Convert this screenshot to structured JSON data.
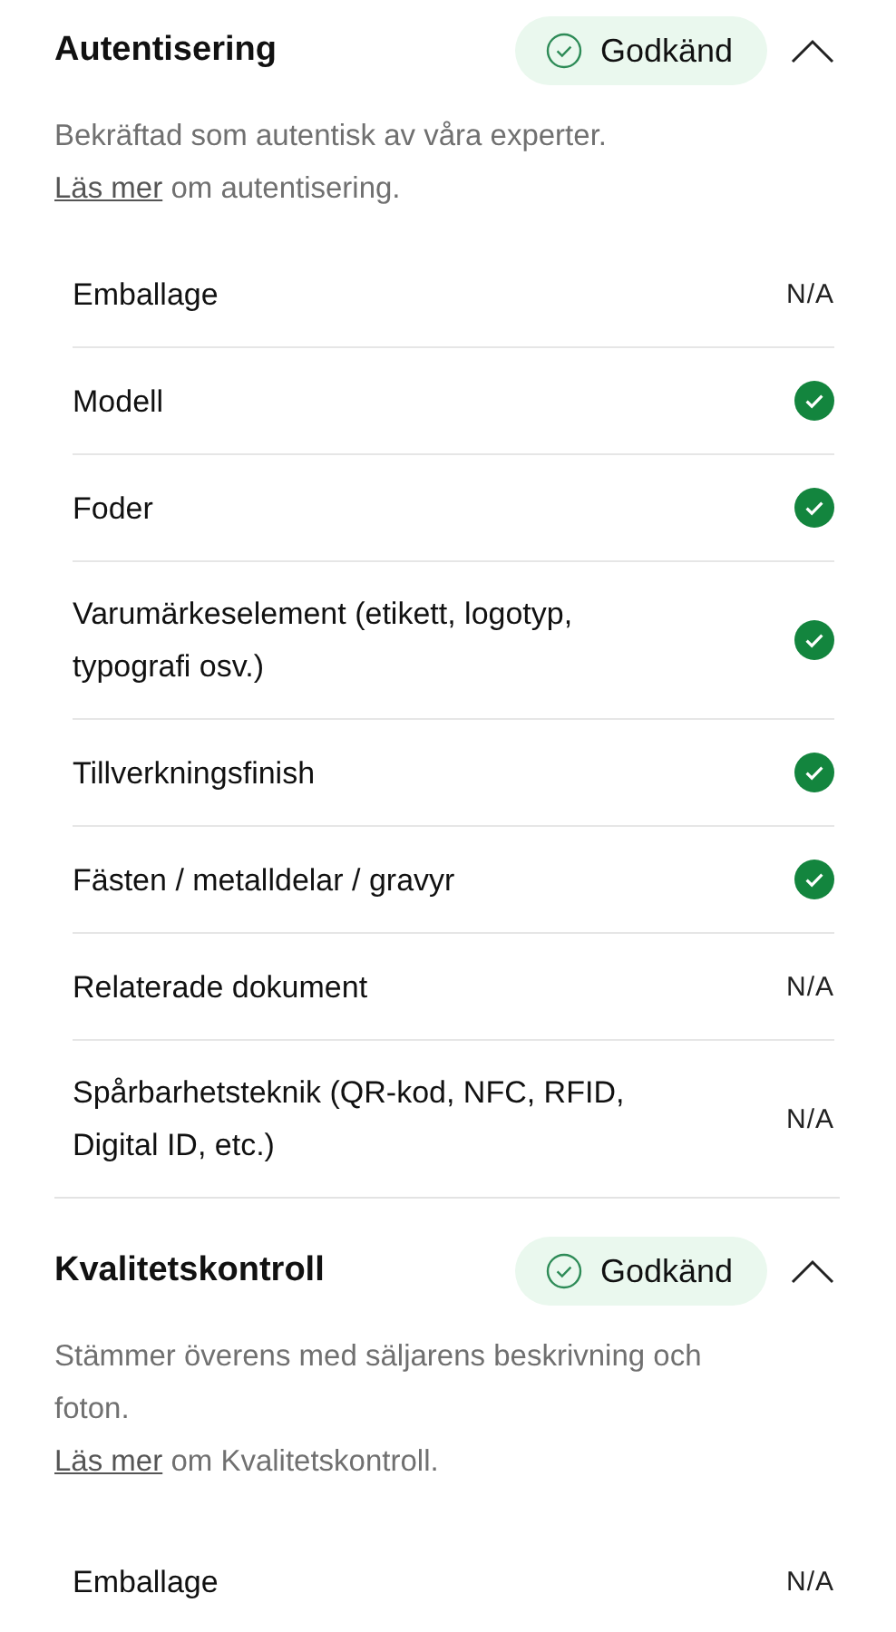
{
  "sections": [
    {
      "title": "Autentisering",
      "status": "Godkänd",
      "expanded": true,
      "description": "Bekräftad som autentisk av våra experter.",
      "link": "Läs mer",
      "link_suffix": " om autentisering.",
      "items": [
        {
          "label": "Emballage",
          "kind": "na",
          "result": "N/A"
        },
        {
          "label": "Modell",
          "kind": "check"
        },
        {
          "label": "Foder",
          "kind": "check"
        },
        {
          "label": "Varumärkeselement (etikett, logotyp, typografi osv.)",
          "kind": "check"
        },
        {
          "label": "Tillverkningsfinish",
          "kind": "check"
        },
        {
          "label": "Fästen / metalldelar / gravyr",
          "kind": "check"
        },
        {
          "label": "Relaterade dokument",
          "kind": "na",
          "result": "N/A"
        },
        {
          "label": "Spårbarhetsteknik (QR-kod, NFC, RFID, Digital ID, etc.)",
          "kind": "na",
          "result": "N/A"
        }
      ]
    },
    {
      "title": "Kvalitetskontroll",
      "status": "Godkänd",
      "expanded": true,
      "description": "Stämmer överens med säljarens beskrivning och foton.",
      "link": "Läs mer",
      "link_suffix": " om Kvalitetskontroll.",
      "items": [
        {
          "label": "Emballage",
          "kind": "na",
          "result": "N/A"
        }
      ]
    }
  ]
}
